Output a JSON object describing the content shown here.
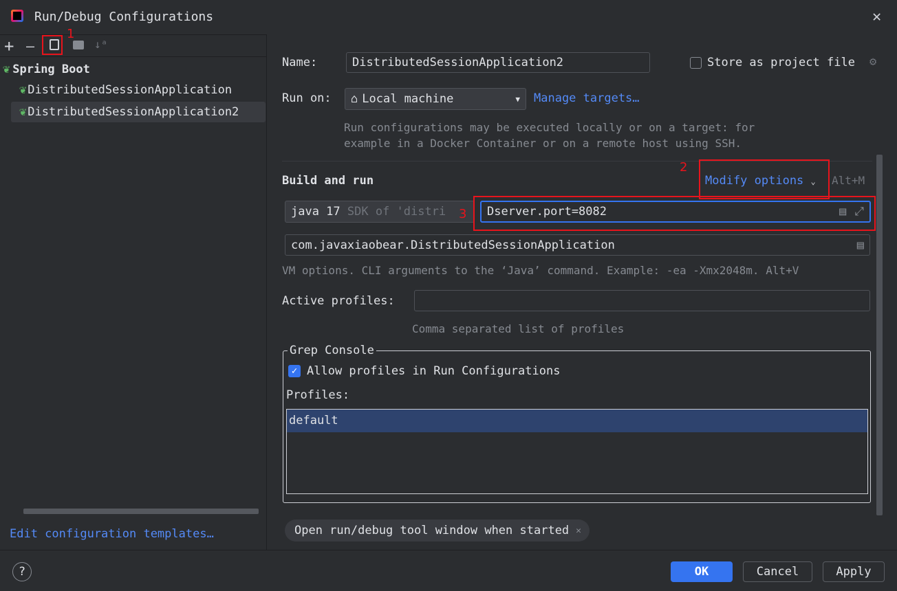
{
  "window": {
    "title": "Run/Debug Configurations",
    "close_icon": "close-icon"
  },
  "toolbar": {
    "add": "+",
    "remove": "—",
    "annotation_1": "1"
  },
  "tree": {
    "group": "Spring Boot",
    "items": [
      {
        "label": "DistributedSessionApplication",
        "selected": false
      },
      {
        "label": "DistributedSessionApplication2",
        "selected": true
      }
    ]
  },
  "edit_templates": "Edit configuration templates…",
  "form": {
    "name_label": "Name:",
    "name_value": "DistributedSessionApplication2",
    "store_label": "Store as project file",
    "store_checked": false,
    "run_on_label": "Run on:",
    "run_on_value": "Local machine",
    "manage_targets": "Manage targets…",
    "run_on_hint1": "Run configurations may be executed locally or on a target: for",
    "run_on_hint2": "example in a Docker Container or on a remote host using SSH.",
    "build_run": "Build and run",
    "modify_options": "Modify options",
    "modify_shortcut": "Alt+M",
    "annotation_2": "2",
    "annotation_3": "3",
    "jdk_main": "java 17",
    "jdk_sub": "SDK of 'distri",
    "vm_options": "Dserver.port=8082",
    "main_class": "com.javaxiaobear.DistributedSessionApplication",
    "vm_hint": "VM options. CLI arguments to the ‘Java’ command. Example: -ea -Xmx2048m. Alt+V",
    "profiles_label": "Active profiles:",
    "profiles_value": "",
    "profiles_hint": "Comma separated list of profiles",
    "grep_title": "Grep Console",
    "allow_profiles": "Allow profiles in Run Configurations",
    "allow_checked": true,
    "profiles_list_label": "Profiles:",
    "profiles_list": [
      "default"
    ],
    "chip": "Open run/debug tool window when started"
  },
  "footer": {
    "help": "?",
    "ok": "OK",
    "cancel": "Cancel",
    "apply": "Apply"
  },
  "colors": {
    "accent": "#3574f0",
    "link": "#548af7",
    "annotation": "#e8141c"
  }
}
